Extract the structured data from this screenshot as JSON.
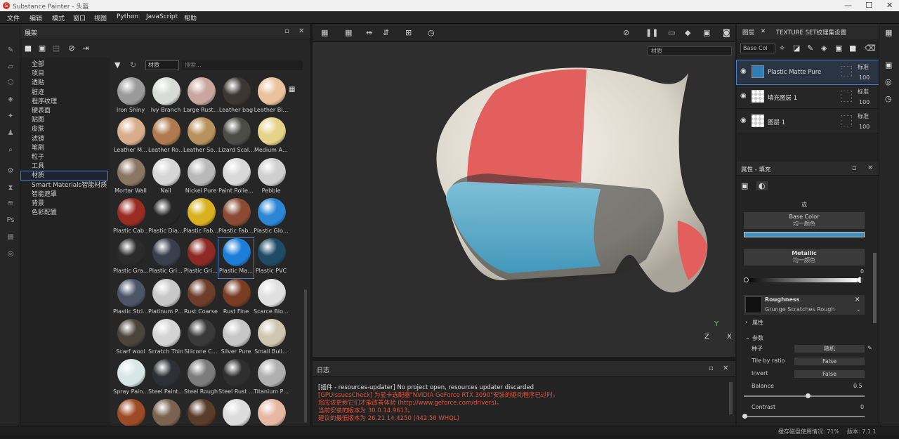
{
  "window": {
    "title": "Substance Painter - 头盔",
    "minimize": "—",
    "maximize": "☐",
    "close": "✕"
  },
  "menu": [
    "文件",
    "编辑",
    "模式",
    "窗口",
    "视图",
    "Python",
    "JavaScript",
    "帮助"
  ],
  "shelf": {
    "title": "展架",
    "categories": [
      "全部",
      "项目",
      "透贴",
      "脏迹",
      "程序纹理",
      "硬表面",
      "贴图",
      "皮肤",
      "滤镜",
      "笔刷",
      "粒子",
      "工具",
      "材质",
      "Smart Materials智能材质",
      "智能遮罩",
      "背景",
      "色彩配置"
    ],
    "selected_category": "材质",
    "filter_tag": "材质",
    "search_placeholder": "搜索...",
    "materials": [
      {
        "name": "Iron Shiny",
        "color": "#9a9a9a"
      },
      {
        "name": "Ivy Branch",
        "color": "#d8dcd6"
      },
      {
        "name": "Large Rust…",
        "color": "#c9a7a0"
      },
      {
        "name": "Leather bag",
        "color": "#3d3733"
      },
      {
        "name": "Leather Bi…",
        "color": "#e8c29a"
      },
      {
        "name": "Leather M…",
        "color": "#d8ad8c"
      },
      {
        "name": "Leather Ro…",
        "color": "#b07a4e"
      },
      {
        "name": "Leather So…",
        "color": "#b8925c"
      },
      {
        "name": "Lizard Scal…",
        "color": "#4b4c46"
      },
      {
        "name": "Medium A…",
        "color": "#e6d38a"
      },
      {
        "name": "Mortar Wall",
        "color": "#8b7664"
      },
      {
        "name": "Nail",
        "color": "#d6d6d6"
      },
      {
        "name": "Nickel Pure",
        "color": "#b9b9b9"
      },
      {
        "name": "Paint Rolle…",
        "color": "#d9d9d9"
      },
      {
        "name": "Pebble",
        "color": "#cfcfcf"
      },
      {
        "name": "Plastic Cab…",
        "color": "#9b2c24"
      },
      {
        "name": "Plastic Dia…",
        "color": "#262626"
      },
      {
        "name": "Plastic Fab…",
        "color": "#d9b11e"
      },
      {
        "name": "Plastic Fab…",
        "color": "#8a4a34"
      },
      {
        "name": "Plastic Glo…",
        "color": "#2c86d6"
      },
      {
        "name": "Plastic Gra…",
        "color": "#2b2b2b"
      },
      {
        "name": "Plastic Gri…",
        "color": "#3a3f4d"
      },
      {
        "name": "Plastic Gri…",
        "color": "#8e2a25"
      },
      {
        "name": "Plastic Ma…",
        "color": "#1d7ed8"
      },
      {
        "name": "Plastic PVC",
        "color": "#1f4b67"
      },
      {
        "name": "Plastic Stri…",
        "color": "#4c5468"
      },
      {
        "name": "Platinum P…",
        "color": "#c8c8c8"
      },
      {
        "name": "Rust Coarse",
        "color": "#6e3d2c"
      },
      {
        "name": "Rust Fine",
        "color": "#7a3c22"
      },
      {
        "name": "Scarce Blo…",
        "color": "#e0e0e0"
      },
      {
        "name": "Scarf wool",
        "color": "#4a443c"
      },
      {
        "name": "Scratch Thin",
        "color": "#d4d4d4"
      },
      {
        "name": "Silicone C…",
        "color": "#3a3a3a"
      },
      {
        "name": "Silver Pure",
        "color": "#c6c6c6"
      },
      {
        "name": "Small Bull…",
        "color": "#cfc6b0"
      },
      {
        "name": "Spray Pain…",
        "color": "#d9e6e6"
      },
      {
        "name": "Steel Paint…",
        "color": "#2e3038"
      },
      {
        "name": "Steel Rough",
        "color": "#7c7c7c"
      },
      {
        "name": "Steel Rust …",
        "color": "#2f2f2f"
      },
      {
        "name": "Titanium P…",
        "color": "#b0b0b0"
      },
      {
        "name": "Wood Am…",
        "color": "#9d4a26"
      },
      {
        "name": "Wood Rou…",
        "color": "#7a6450"
      },
      {
        "name": "Wood Wal…",
        "color": "#5a3c2a"
      },
      {
        "name": "Zipper",
        "color": "#dcdcdc"
      },
      {
        "name": "Zombie B…",
        "color": "#e6b8a2"
      }
    ],
    "selected_material": "Plastic Ma…"
  },
  "viewport": {
    "material_select": "材质",
    "axis": {
      "z": "Z",
      "y": "Y",
      "x": "X"
    },
    "helmet_colors": {
      "shell": "#e9e5dc",
      "stripe": "#e15a5a",
      "visor": "#5fb6d6"
    }
  },
  "log": {
    "title": "日志",
    "lines": [
      {
        "text": "[插件 - resources-updater] No project open, resources updater discarded",
        "color": "#e0e0e0"
      },
      {
        "text": "[GPUIssuesCheck] 为显卡选配器\"NVIDIA GeForce RTX 3090\"安装的驱动程序已过时。",
        "color": "#e0553a"
      },
      {
        "text": "您应该更新它们才能改善体验 (http://www.geforce.com/drivers)。",
        "color": "#e0553a"
      },
      {
        "text": "当前安装的版本为 30.0.14.9613。",
        "color": "#e0553a"
      },
      {
        "text": "建议的最低版本为 26.21.14.4250 (442.50 WHQL)",
        "color": "#e0553a"
      }
    ]
  },
  "layers": {
    "tab_layers": "图层",
    "tab_textureset": "TEXTURE SET纹理集设置",
    "channel": "Base Col",
    "items": [
      {
        "name": "Plastic Matte Pure",
        "blend": "标准",
        "opacity": "100",
        "type": "fill"
      },
      {
        "name": "填充图层 1",
        "blend": "标准",
        "opacity": "100",
        "type": "checker"
      },
      {
        "name": "图层 1",
        "blend": "标准",
        "opacity": "100",
        "type": "checker"
      }
    ]
  },
  "properties": {
    "title": "属性 - 填充",
    "or_label": "或",
    "base_color": {
      "label": "Base Color",
      "sub": "均一颜色",
      "swatch": "#3f8fbf"
    },
    "metallic": {
      "label": "Metallic",
      "sub": "均一颜色",
      "value": "0"
    },
    "roughness": {
      "label": "Roughness",
      "sub": "Grunge Scratches Rough"
    },
    "section_attr": "属性",
    "section_params": "参数",
    "seed": {
      "label": "种子",
      "value": "随机"
    },
    "tile_by_ratio": {
      "label": "Tile by ratio",
      "value": "False"
    },
    "invert": {
      "label": "Invert",
      "value": "False"
    },
    "balance": {
      "label": "Balance",
      "value": "0.5"
    },
    "contrast": {
      "label": "Contrast",
      "value": "0"
    }
  },
  "status": {
    "cache": "缓存磁盘使用情况: 71%",
    "version": "版本: 7.1.1"
  }
}
